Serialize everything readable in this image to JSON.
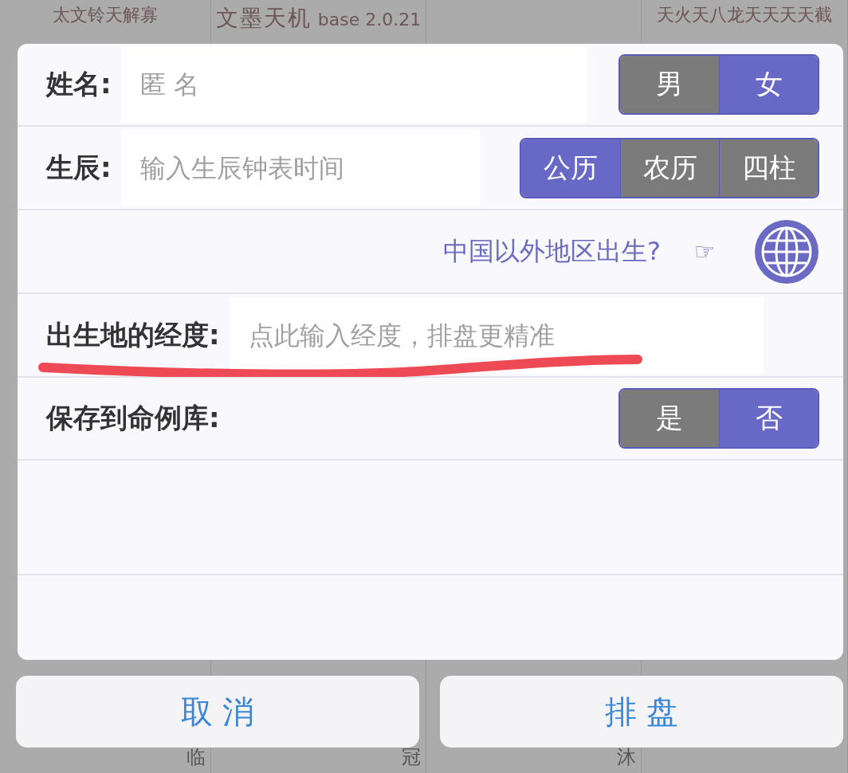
{
  "background": {
    "cells": [
      {
        "lines": [
          "太文铃天解寡"
        ],
        "footer": "临"
      },
      {
        "lines": [
          "文墨天机",
          "base 2.0.21"
        ],
        "footer": "冠"
      },
      {
        "footer": "沐"
      },
      {
        "lines": [
          "天火天八龙天天天天截"
        ]
      }
    ]
  },
  "dialog": {
    "name_row": {
      "label": "姓名:",
      "placeholder": "匿 名",
      "options": [
        {
          "label": "男",
          "selected": false
        },
        {
          "label": "女",
          "selected": true
        }
      ]
    },
    "birth_row": {
      "label": "生辰:",
      "placeholder": "输入生辰钟表时间",
      "options": [
        {
          "label": "公历",
          "selected": true
        },
        {
          "label": "农历",
          "selected": false
        },
        {
          "label": "四柱",
          "selected": false
        }
      ]
    },
    "abroad_row": {
      "link": "中国以外地区出生?",
      "pointer": "☞"
    },
    "longitude_row": {
      "label": "出生地的经度:",
      "placeholder": "点此输入经度，排盘更精准",
      "underlined": true
    },
    "save_row": {
      "label": "保存到命例库:",
      "options": [
        {
          "label": "是",
          "selected": false
        },
        {
          "label": "否",
          "selected": true
        }
      ]
    }
  },
  "buttons": [
    {
      "label": "取 消"
    },
    {
      "label": "排 盘"
    }
  ]
}
